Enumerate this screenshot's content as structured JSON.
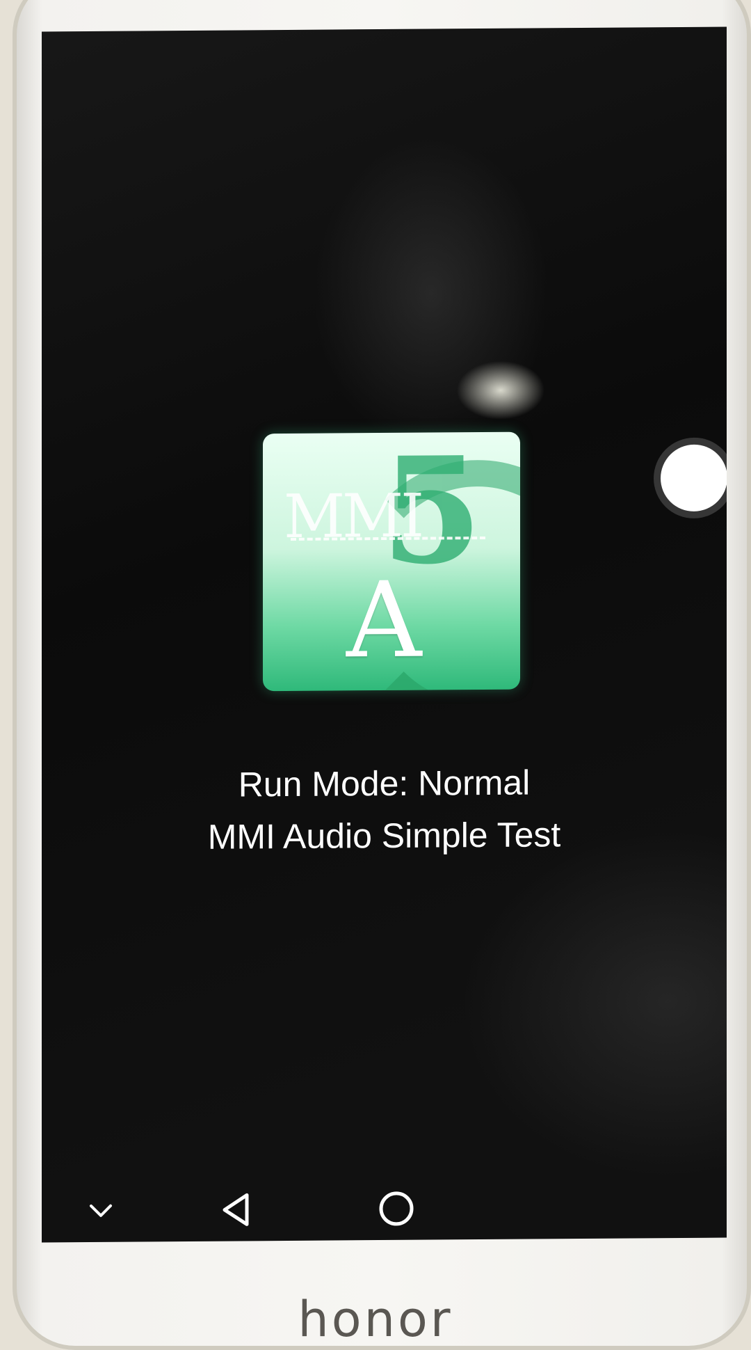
{
  "device": {
    "brand_label": "honor"
  },
  "app": {
    "icon_name": "mmi-test-app-icon",
    "icon_lettering": {
      "top": "MMI",
      "bottom": "A",
      "digit": "5"
    },
    "accent_color": "#2fb97a"
  },
  "status": {
    "run_mode": "Run Mode: Normal",
    "test_name": "MMI Audio Simple Test"
  },
  "navigation_bar": {
    "items": [
      {
        "name": "hide-nav-chevron-down-icon"
      },
      {
        "name": "back-triangle-icon"
      },
      {
        "name": "home-circle-icon"
      }
    ]
  },
  "floating_button": {
    "name": "floating-navigation-dock"
  }
}
